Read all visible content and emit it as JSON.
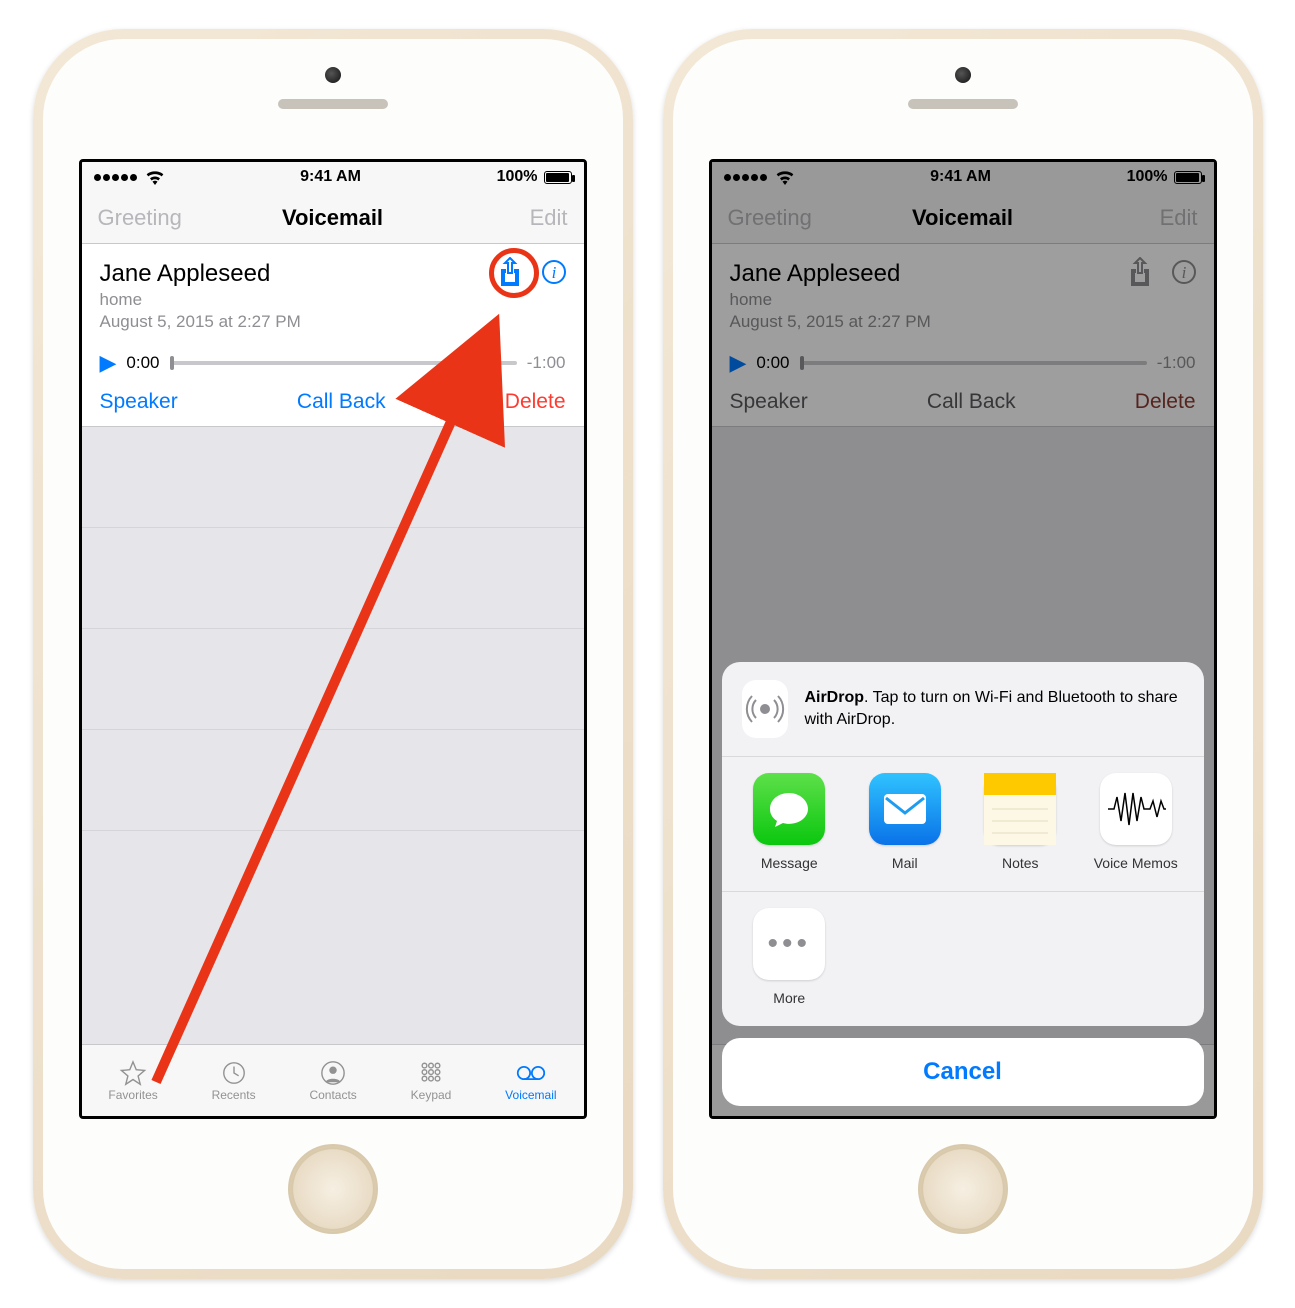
{
  "status": {
    "time": "9:41 AM",
    "battery": "100%"
  },
  "nav": {
    "left": "Greeting",
    "title": "Voicemail",
    "right": "Edit"
  },
  "voicemail": {
    "name": "Jane Appleseed",
    "label": "home",
    "date": "August 5, 2015 at 2:27 PM",
    "elapsed": "0:00",
    "remaining": "-1:00"
  },
  "actions": {
    "speaker": "Speaker",
    "callback": "Call Back",
    "delete": "Delete"
  },
  "tabs": {
    "favorites": "Favorites",
    "recents": "Recents",
    "contacts": "Contacts",
    "keypad": "Keypad",
    "voicemail": "Voicemail"
  },
  "airdrop": {
    "title": "AirDrop",
    "desc": ". Tap to turn on Wi-Fi and Bluetooth to share with AirDrop."
  },
  "share": {
    "message": "Message",
    "mail": "Mail",
    "notes": "Notes",
    "voicememos": "Voice Memos",
    "more": "More"
  },
  "cancel": "Cancel"
}
